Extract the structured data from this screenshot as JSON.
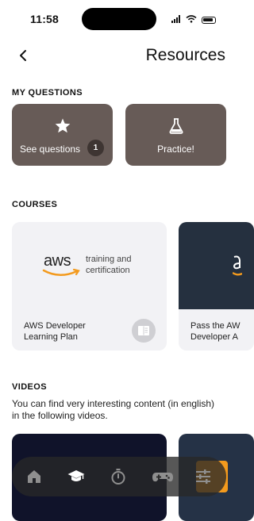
{
  "status_bar": {
    "time": "11:58"
  },
  "header": {
    "title": "Resources"
  },
  "my_questions": {
    "label": "MY QUESTIONS",
    "see_questions_label": "See questions",
    "see_questions_count": "1",
    "practice_label": "Practice!"
  },
  "courses": {
    "label": "COURSES",
    "items": [
      {
        "title_line1": "AWS Developer",
        "title_line2": "Learning Plan",
        "logo_word": "aws",
        "logo_sub_line1": "training and",
        "logo_sub_line2": "certification"
      },
      {
        "title_line1": "Pass the AW",
        "title_line2": "Developer A"
      }
    ]
  },
  "videos": {
    "label": "VIDEOS",
    "description": "You can find very interesting content (in english) in the following videos."
  },
  "bottom_nav": {
    "items": [
      "home-icon",
      "graduation-cap-icon",
      "stopwatch-icon",
      "gamepad-icon",
      "sliders-icon"
    ],
    "colors": {
      "background": "#282828",
      "accent": "#f39a1d"
    }
  },
  "colors": {
    "card": "#675b57",
    "badge": "#3e3532",
    "course_bg": "#f2f2f5"
  }
}
